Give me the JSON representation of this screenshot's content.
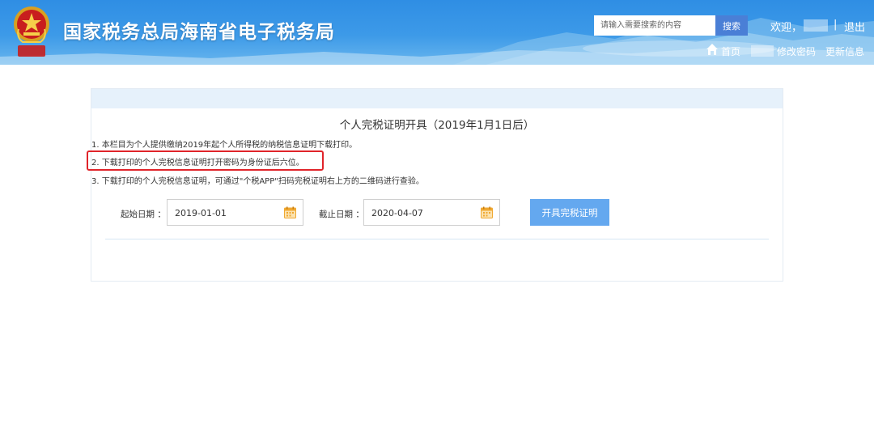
{
  "header": {
    "site_title": "国家税务总局海南省电子税务局",
    "emblem_text": "中国税务",
    "search_placeholder": "请输入需要搜索的内容",
    "search_button": "搜索",
    "welcome": "欢迎，",
    "separator": "|",
    "logout": "退出",
    "nav": {
      "home": "首页",
      "change_password": "修改密码",
      "update_info": "更新信息"
    }
  },
  "panel": {
    "title": "个人完税证明开具（2019年1月1日后）",
    "notes": [
      "1. 本栏目为个人提供缴纳2019年起个人所得税的纳税信息证明下载打印。",
      "2. 下载打印的个人完税信息证明打开密码为身份证后六位。",
      "3. 下载打印的个人完税信息证明，可通过\"个税APP\"扫码完税证明右上方的二维码进行查验。"
    ],
    "start_label": "起始日期 ：",
    "start_value": "2019-01-01",
    "end_label": "截止日期 ：",
    "end_value": "2020-04-07",
    "issue_button": "开具完税证明"
  },
  "colors": {
    "header_blue": "#3d9ae8",
    "search_button": "#4a7fd6",
    "primary_button": "#64a8ef",
    "panel_bar": "#e6f1fb",
    "highlight_red": "#e0242a",
    "calendar_orange": "#f0a830"
  },
  "icons": {
    "home": "home-icon",
    "calendar": "calendar-icon",
    "emblem": "tax-emblem-icon"
  }
}
